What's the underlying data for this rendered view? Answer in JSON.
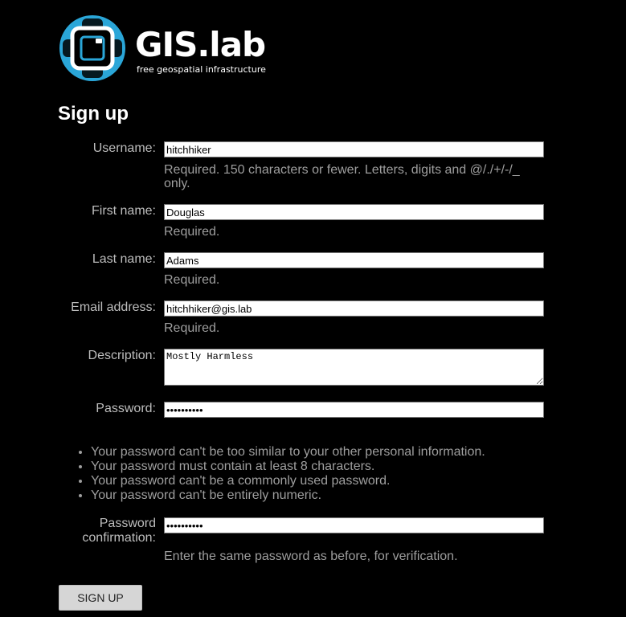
{
  "brand": {
    "title": "GIS.lab",
    "tagline": "free geospatial infrastructure",
    "accent": "#2aa6d8"
  },
  "page": {
    "heading": "Sign up"
  },
  "form": {
    "username": {
      "label": "Username:",
      "value": "hitchhiker",
      "help": "Required. 150 characters or fewer. Letters, digits and @/./+/-/_ only."
    },
    "first_name": {
      "label": "First name:",
      "value": "Douglas",
      "help": "Required."
    },
    "last_name": {
      "label": "Last name:",
      "value": "Adams",
      "help": "Required."
    },
    "email": {
      "label": "Email address:",
      "value": "hitchhiker@gis.lab",
      "help": "Required."
    },
    "description": {
      "label": "Description:",
      "value": "Mostly Harmless"
    },
    "password": {
      "label": "Password:",
      "value": "••••••••••",
      "rules": [
        "Your password can't be too similar to your other personal information.",
        "Your password must contain at least 8 characters.",
        "Your password can't be a commonly used password.",
        "Your password can't be entirely numeric."
      ]
    },
    "password_confirm": {
      "label_line1": "Password",
      "label_line2": "confirmation:",
      "value": "••••••••••",
      "help": "Enter the same password as before, for verification."
    },
    "submit_label": "SIGN UP"
  }
}
